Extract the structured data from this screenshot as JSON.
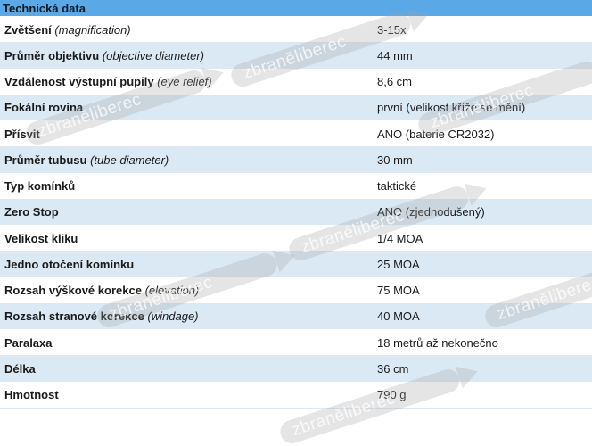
{
  "header": {
    "title": "Technická data"
  },
  "rows": [
    {
      "label": "Zvětšení",
      "note": "(magnification)",
      "value": "3-15x"
    },
    {
      "label": "Průměr objektivu",
      "note": "(objective diameter)",
      "value": "44 mm"
    },
    {
      "label": "Vzdálenost výstupní pupily",
      "note": "(eye relief)",
      "value": "8,6 cm"
    },
    {
      "label": "Fokální rovina",
      "note": "",
      "value": "první (velikost kříže se mění)"
    },
    {
      "label": "Přísvit",
      "note": "",
      "value": "ANO (baterie CR2032)"
    },
    {
      "label": "Průměr tubusu",
      "note": "(tube diameter)",
      "value": "30 mm"
    },
    {
      "label": "Typ komínků",
      "note": "",
      "value": "taktické"
    },
    {
      "label": "Zero Stop",
      "note": "",
      "value": "ANO (zjednodušený)"
    },
    {
      "label": "Velikost kliku",
      "note": "",
      "value": "1/4 MOA"
    },
    {
      "label": "Jedno otočení komínku",
      "note": "",
      "value": "25 MOA"
    },
    {
      "label": "Rozsah výškové korekce",
      "note": "(elevation)",
      "value": "75 MOA"
    },
    {
      "label": "Rozsah stranové korekce",
      "note": "(windage)",
      "value": "40 MOA"
    },
    {
      "label": "Paralaxa",
      "note": "",
      "value": "18 metrů až nekonečno"
    },
    {
      "label": "Délka",
      "note": "",
      "value": "36 cm"
    },
    {
      "label": "Hmotnost",
      "note": "",
      "value": "790 g"
    }
  ],
  "watermark": {
    "text": "zbraněliberec"
  },
  "colors": {
    "header": "#5aa9e6",
    "row_alt": "#dbe9f5"
  }
}
